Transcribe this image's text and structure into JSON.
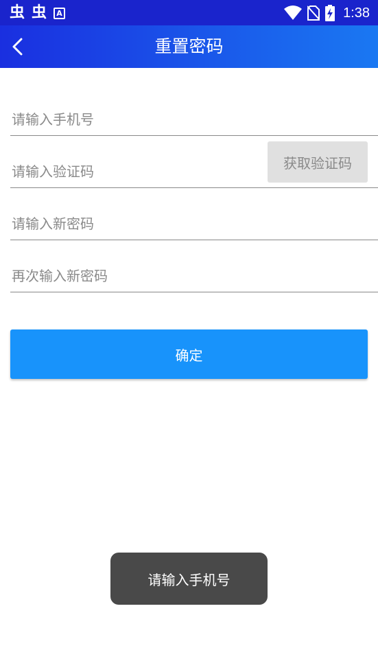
{
  "status_bar": {
    "left_icons": [
      "bug-icon",
      "bug-icon",
      "a-accessibility-icon"
    ],
    "right_icons": [
      "wifi-icon",
      "no-sim-icon",
      "battery-charging-icon"
    ],
    "time": "1:38"
  },
  "header": {
    "back_icon": "chevron-left-icon",
    "title": "重置密码",
    "gradient": [
      "#1a2fe0",
      "#1a78f2"
    ]
  },
  "form": {
    "phone_placeholder": "请输入手机号",
    "code_placeholder": "请输入验证码",
    "get_code_label": "获取验证码",
    "new_password_placeholder": "请输入新密码",
    "confirm_password_placeholder": "再次输入新密码",
    "submit_label": "确定"
  },
  "toast": {
    "message": "请输入手机号"
  },
  "colors": {
    "accent": "#1893fb",
    "status_bar": "#1a24cc",
    "toast_bg": "#494949",
    "disabled_button_bg": "#e0e0e0"
  }
}
